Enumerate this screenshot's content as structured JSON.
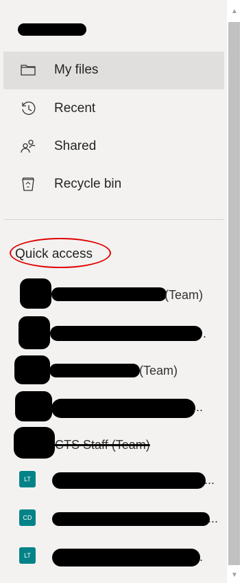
{
  "header": {
    "name_redacted": ""
  },
  "nav": {
    "items": [
      {
        "label": "My files",
        "icon": "folder-icon",
        "active": true
      },
      {
        "label": "Recent",
        "icon": "history-icon",
        "active": false
      },
      {
        "label": "Shared",
        "icon": "people-icon",
        "active": false
      },
      {
        "label": "Recycle bin",
        "icon": "recycle-bin-icon",
        "active": false
      }
    ]
  },
  "quick_access": {
    "title": "Quick access",
    "items": [
      {
        "suffix": "(Team)"
      },
      {
        "suffix": "."
      },
      {
        "suffix": "(Team)"
      },
      {
        "suffix": "..."
      },
      {
        "suffix": "CTS Staff (Team)"
      },
      {
        "avatar": "LT",
        "suffix": "..."
      },
      {
        "avatar": "CD",
        "suffix": "..."
      },
      {
        "avatar": "LT",
        "suffix": "."
      }
    ]
  },
  "scrollbar": {
    "up": "▲",
    "down": "▼"
  }
}
